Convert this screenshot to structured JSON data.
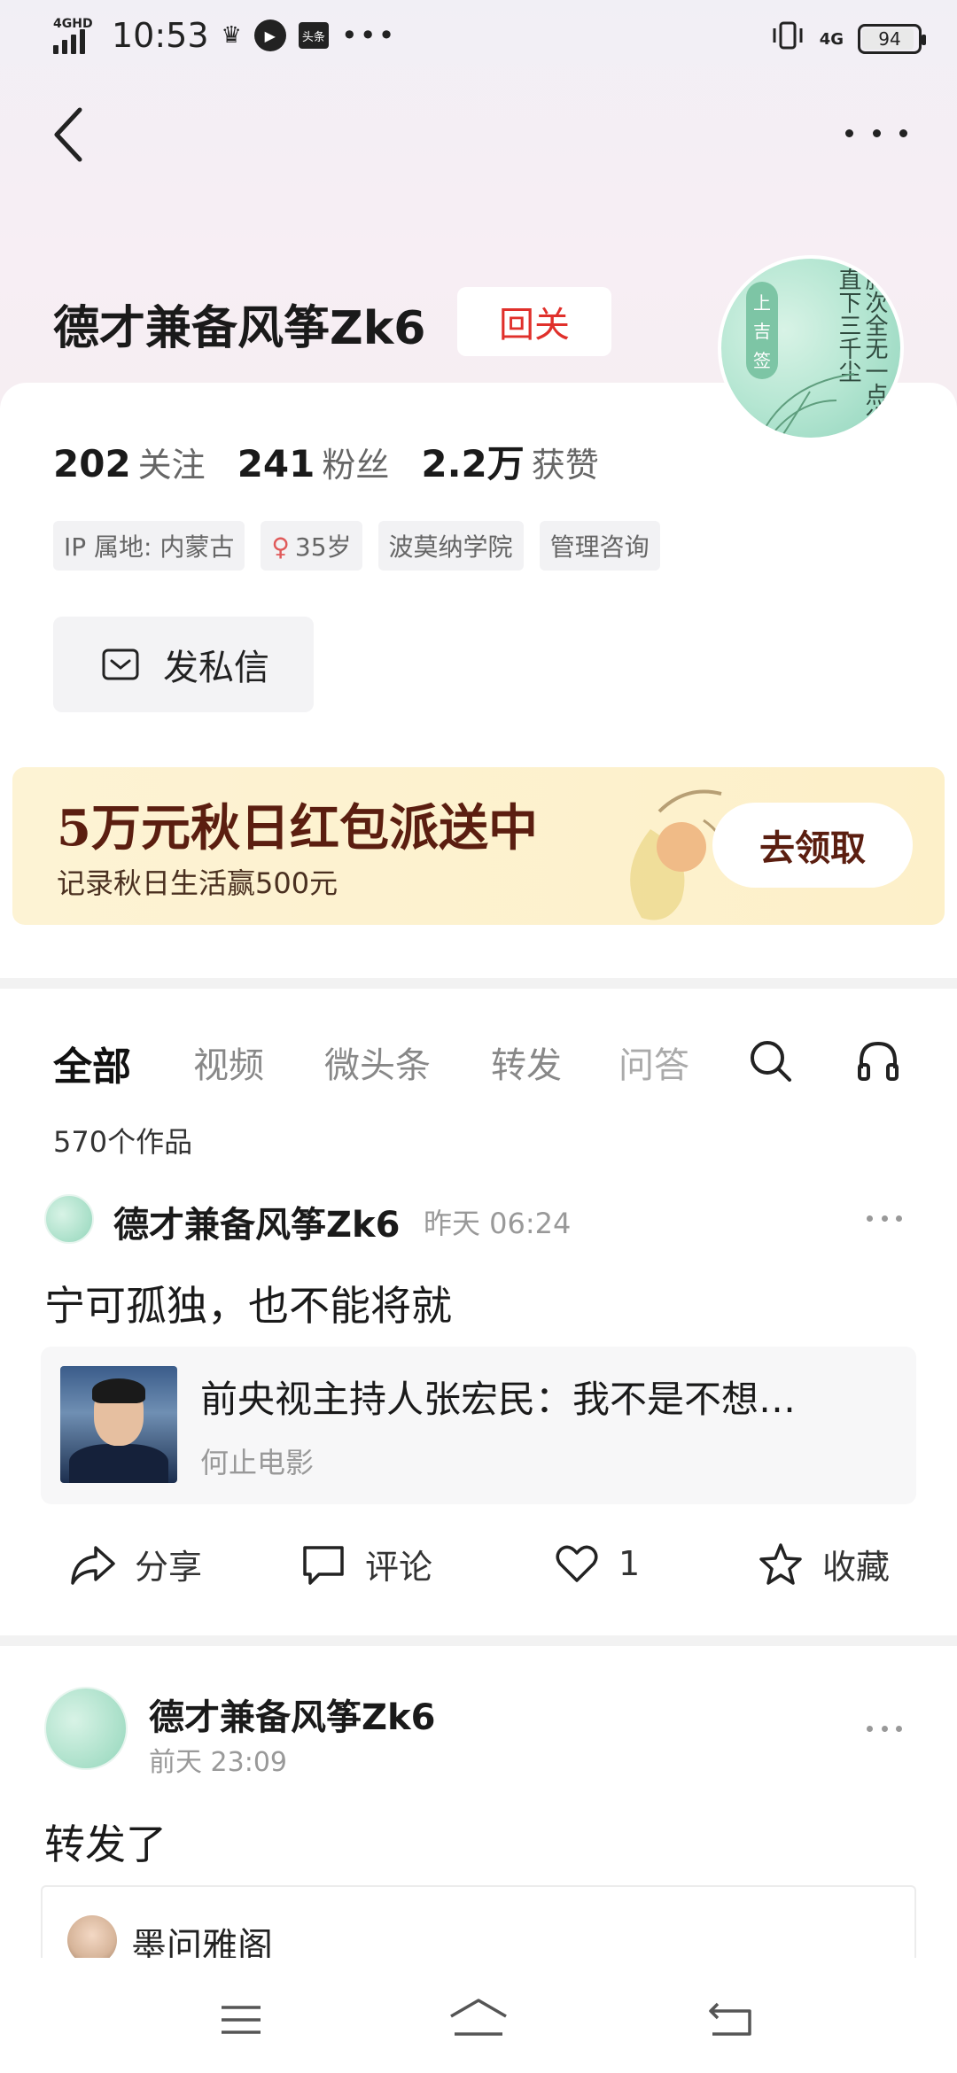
{
  "status_bar": {
    "network_label": "4GHD",
    "time": "10:53",
    "app_badge": "头条",
    "more": "•••",
    "network_right": "4G",
    "battery": "94"
  },
  "profile": {
    "username": "德才兼备风筝Zk6",
    "follow_back_label": "回关",
    "avatar_seal": [
      "上",
      "吉",
      "签"
    ],
    "avatar_poem": "胸次全无一点尘直下三千尘",
    "stats": [
      {
        "num": "202",
        "label": "关注"
      },
      {
        "num": "241",
        "label": "粉丝"
      },
      {
        "num": "2.2万",
        "label": "获赞"
      }
    ],
    "tags": {
      "ip": "IP 属地: 内蒙古",
      "gender_symbol": "♀",
      "age": "35岁",
      "school": "波莫纳学院",
      "field": "管理咨询"
    },
    "dm_label": "发私信"
  },
  "banner": {
    "title": "5万元秋日红包派送中",
    "subtitle": "记录秋日生活赢500元",
    "claim_label": "去领取"
  },
  "tabs": {
    "items": [
      "全部",
      "视频",
      "微头条",
      "转发",
      "问答"
    ],
    "active": "全部"
  },
  "works_count": "570个作品",
  "post1": {
    "user": "德才兼备风筝Zk6",
    "time": "昨天  06:24",
    "text": "宁可孤独，也不能将就",
    "link_title": "前央视主持人张宏民：我不是不想…",
    "link_source": "何止电影",
    "actions": {
      "share": "分享",
      "comment": "评论",
      "like_count": "1",
      "favorite": "收藏"
    }
  },
  "post2": {
    "user": "德才兼备风筝Zk6",
    "time": "前天  23:09",
    "text": "转发了",
    "quoted_user": "墨问雅阁"
  }
}
